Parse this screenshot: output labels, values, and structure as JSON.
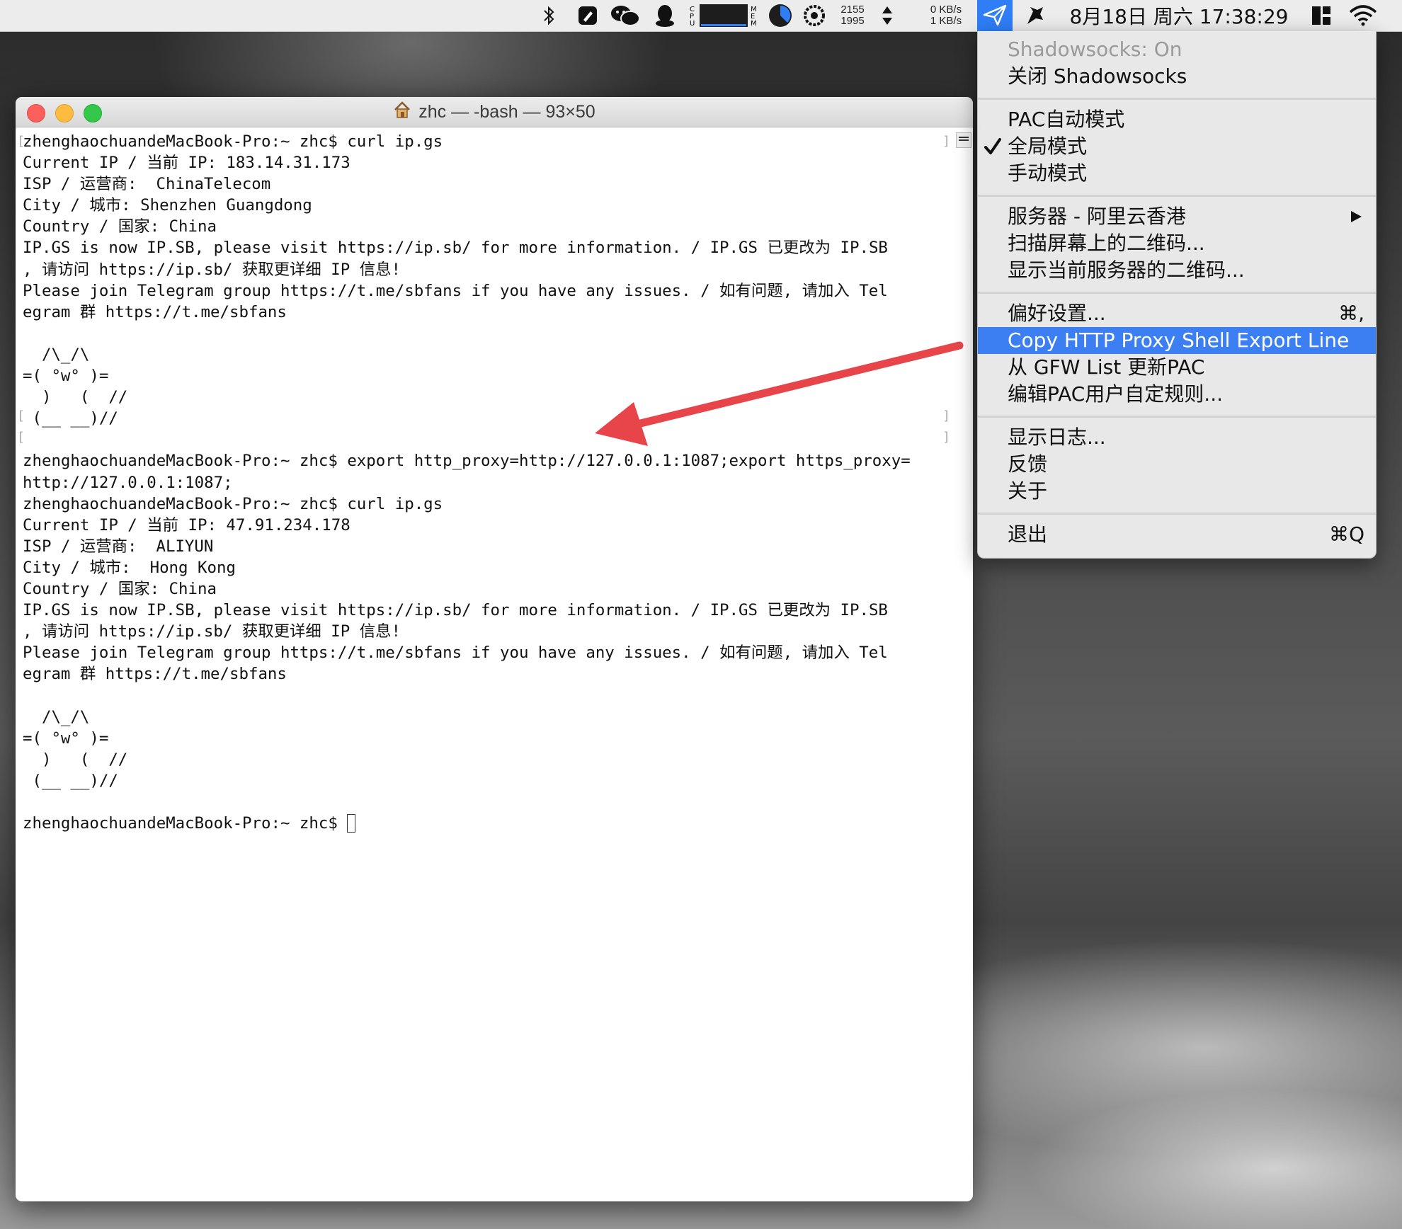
{
  "menubar": {
    "network": [
      "0 KB/s",
      "1 KB/s"
    ],
    "counters": [
      "2155",
      "1995"
    ],
    "clock": "8月18日 周六 17:38:29"
  },
  "window": {
    "title": "zhc — -bash — 93×50",
    "lines": [
      "zhenghaochuandeMacBook-Pro:~ zhc$ curl ip.gs",
      "Current IP / 当前 IP: 183.14.31.173",
      "ISP / 运营商:  ChinaTelecom",
      "City / 城市: Shenzhen Guangdong",
      "Country / 国家: China",
      "IP.GS is now IP.SB, please visit https://ip.sb/ for more information. / IP.GS 已更改为 IP.SB",
      ", 请访问 https://ip.sb/ 获取更详细 IP 信息!",
      "Please join Telegram group https://t.me/sbfans if you have any issues. / 如有问题, 请加入 Tel",
      "egram 群 https://t.me/sbfans",
      "",
      "  /\\_/\\",
      "=( °w° )=",
      "  )   (  //",
      " (__ __)//",
      "",
      "zhenghaochuandeMacBook-Pro:~ zhc$ export http_proxy=http://127.0.0.1:1087;export https_proxy=",
      "http://127.0.0.1:1087;",
      "zhenghaochuandeMacBook-Pro:~ zhc$ curl ip.gs",
      "Current IP / 当前 IP: 47.91.234.178",
      "ISP / 运营商:  ALIYUN",
      "City / 城市:  Hong Kong",
      "Country / 国家: China",
      "IP.GS is now IP.SB, please visit https://ip.sb/ for more information. / IP.GS 已更改为 IP.SB",
      ", 请访问 https://ip.sb/ 获取更详细 IP 信息!",
      "Please join Telegram group https://t.me/sbfans if you have any issues. / 如有问题, 请加入 Tel",
      "egram 群 https://t.me/sbfans",
      "",
      "  /\\_/\\",
      "=( °w° )=",
      "  )   (  //",
      " (__ __)//",
      ""
    ],
    "prompt": "zhenghaochuandeMacBook-Pro:~ zhc$ "
  },
  "menu": {
    "status": "Shadowsocks: On",
    "toggle": "关闭 Shadowsocks",
    "mode_pac": "PAC自动模式",
    "mode_global": "全局模式",
    "mode_manual": "手动模式",
    "server": "服务器 - 阿里云香港",
    "scan_qr": "扫描屏幕上的二维码...",
    "show_qr": "显示当前服务器的二维码...",
    "preferences": "偏好设置...",
    "preferences_shortcut": "⌘,",
    "copy_export": "Copy HTTP Proxy Shell Export Line",
    "update_pac": "从 GFW List 更新PAC",
    "edit_pac": "编辑PAC用户自定规则...",
    "show_log": "显示日志...",
    "feedback": "反馈",
    "about": "关于",
    "quit": "退出",
    "quit_shortcut": "⌘Q"
  },
  "colors": {
    "highlight": "#3b7ff3",
    "annotation_arrow": "#e8454b"
  },
  "icons": {
    "status": [
      "bluetooth-icon",
      "notes-icon",
      "wechat-icon",
      "qq-icon",
      "cpu-meter-icon",
      "memory-meter-icon",
      "activity-icon",
      "sort-arrows-icon",
      "shadowsocks-icon",
      "paper-plane-icon",
      "window-layout-icon",
      "wifi-icon"
    ],
    "title": "home-folder-icon",
    "menu": [
      "checkmark-icon",
      "submenu-arrow-icon"
    ]
  }
}
